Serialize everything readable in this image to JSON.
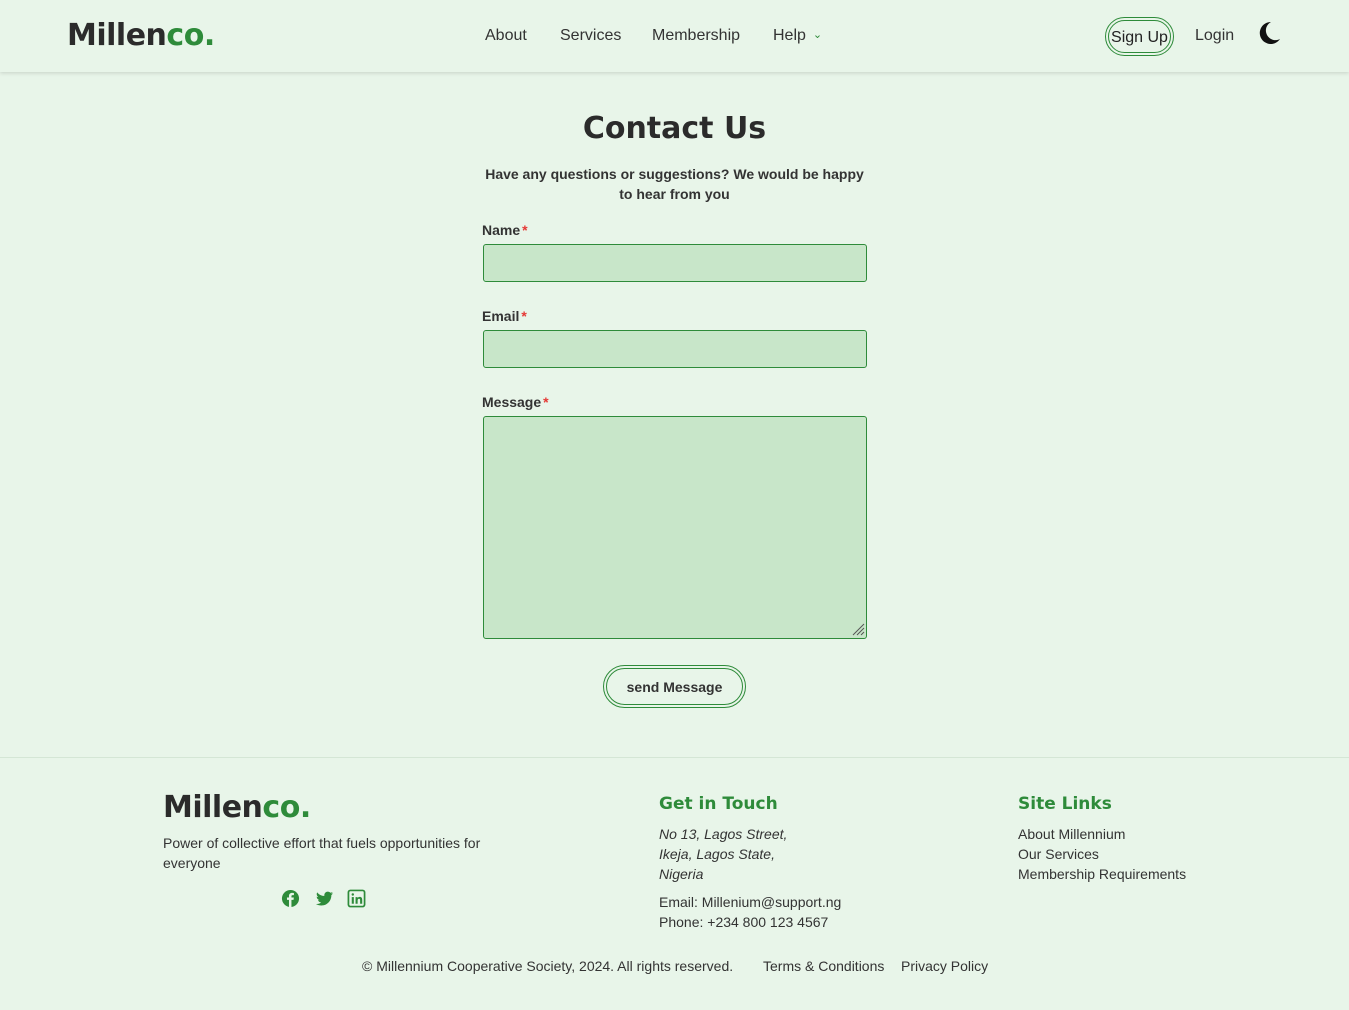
{
  "header": {
    "logo": {
      "main": "Millen",
      "accent": "co."
    },
    "nav": {
      "about": "About",
      "services": "Services",
      "membership": "Membership",
      "help": "Help"
    },
    "signup": "Sign Up",
    "login": "Login",
    "theme_toggle_icon": "moon-icon"
  },
  "form": {
    "title": "Contact Us",
    "subtitle": "Have any questions or suggestions? We would be happy to hear from you",
    "name_label": "Name",
    "email_label": "Email",
    "message_label": "Message",
    "required_mark": "*",
    "name_value": "",
    "email_value": "",
    "message_value": "",
    "submit": "send Message"
  },
  "footer": {
    "logo": {
      "main": "Millen",
      "accent": "co."
    },
    "tagline": "Power of collective effort that fuels opportunities for everyone",
    "social_icons": [
      "facebook-icon",
      "twitter-icon",
      "linkedin-icon"
    ],
    "get_in_touch": {
      "heading": "Get in Touch",
      "address": [
        "No 13, Lagos Street,",
        "Ikeja, Lagos State,",
        "Nigeria"
      ],
      "email": "Email: Millenium@support.ng",
      "phone": "Phone: +234 800 123 4567"
    },
    "site_links": {
      "heading": "Site Links",
      "links": [
        "About Millennium",
        "Our Services",
        "Membership Requirements"
      ]
    },
    "copyright": "© Millennium Cooperative Society, 2024. All rights reserved.",
    "terms": "Terms & Conditions",
    "privacy": "Privacy Policy"
  },
  "colors": {
    "accent": "#2e8b3a",
    "background": "#e8f5e9",
    "field": "#c8e6c9",
    "required": "#e53935"
  }
}
